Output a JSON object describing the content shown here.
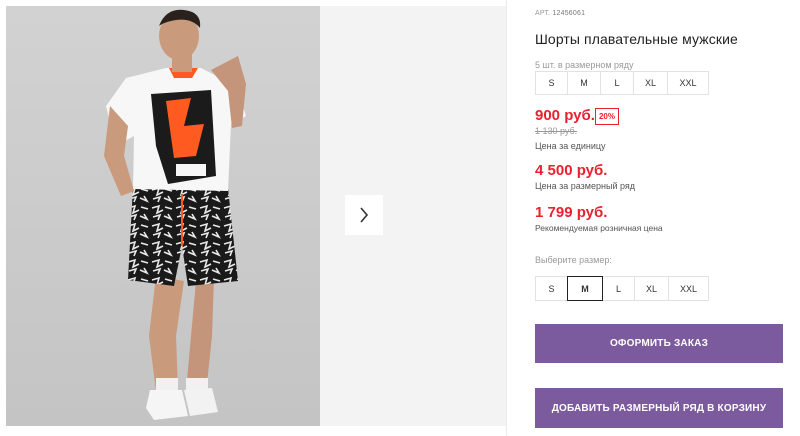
{
  "product": {
    "article_label": "АРТ.",
    "article_number": "12456061",
    "title": "Шорты плавательные мужские",
    "pack_note": "5 шт. в размерном ряду",
    "pack_sizes": [
      "S",
      "M",
      "L",
      "XL",
      "XXL"
    ],
    "price": "900 руб.",
    "discount": "20%",
    "old_price": "1 130 руб.",
    "unit_price_label": "Цена за единицу",
    "pack_price": "4 500 руб.",
    "pack_price_label": "Цена за размерный ряд",
    "rrp": "1 799 руб.",
    "rrp_label": "Рекомендуемая розничная цена"
  },
  "size_picker": {
    "label": "Выберите размер:",
    "options": [
      "S",
      "M",
      "L",
      "XL",
      "XXL"
    ],
    "selected": "M"
  },
  "actions": {
    "order_label": "Оформить заказ",
    "add_to_cart_label": "Добавить размерный ряд в корзину"
  },
  "gallery": {
    "next_icon": "chevron-right-icon"
  },
  "colors": {
    "price_red": "#e8212e",
    "button_purple": "#7b5a9e",
    "photo_bg": "#cfcfcf",
    "gallery_bg": "#f3f3f3"
  }
}
